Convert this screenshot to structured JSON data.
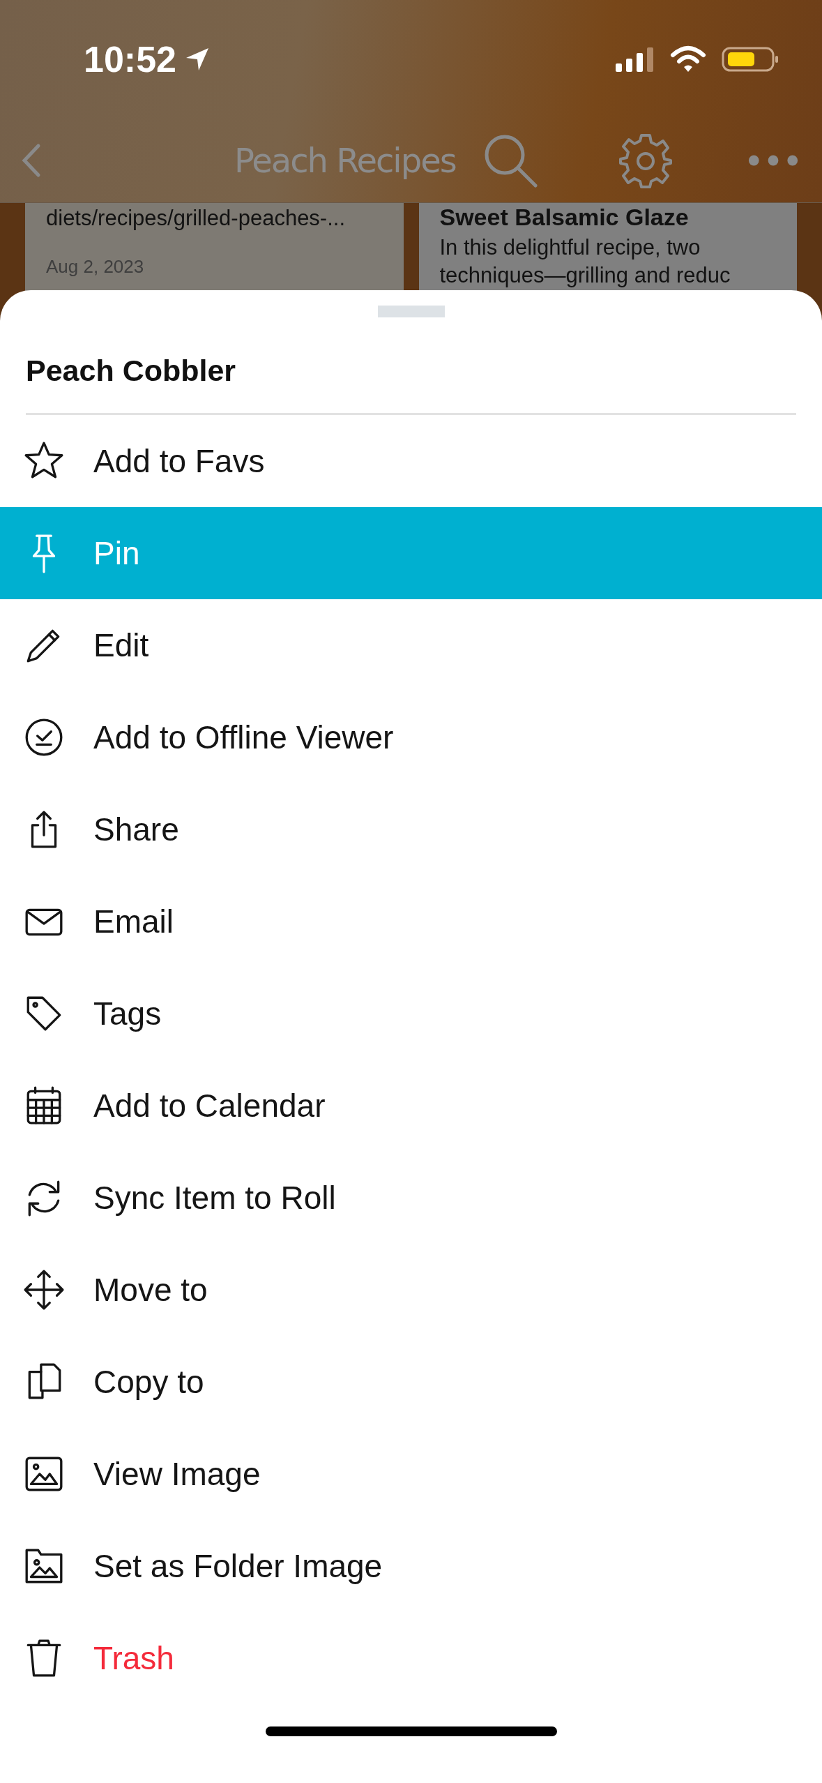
{
  "status_bar": {
    "time": "10:52"
  },
  "nav_bar": {
    "title": "Peach Recipes"
  },
  "background_cards": [
    {
      "lines": [
        "diets/recipes/grilled-peaches-..."
      ],
      "date": "Aug 2, 2023"
    },
    {
      "title": "Sweet Balsamic Glaze",
      "lines": [
        "In this delightful recipe, two",
        "techniques—grilling and reduc"
      ]
    }
  ],
  "sheet": {
    "title": "Peach Cobbler",
    "items": [
      {
        "label": "Add to Favs",
        "selected": false,
        "kind": "normal"
      },
      {
        "label": "Pin",
        "selected": true,
        "kind": "normal"
      },
      {
        "label": "Edit",
        "selected": false,
        "kind": "normal"
      },
      {
        "label": "Add to Offline Viewer",
        "selected": false,
        "kind": "normal"
      },
      {
        "label": "Share",
        "selected": false,
        "kind": "normal"
      },
      {
        "label": "Email",
        "selected": false,
        "kind": "normal"
      },
      {
        "label": "Tags",
        "selected": false,
        "kind": "normal"
      },
      {
        "label": "Add to Calendar",
        "selected": false,
        "kind": "normal"
      },
      {
        "label": "Sync Item to Roll",
        "selected": false,
        "kind": "normal"
      },
      {
        "label": "Move to",
        "selected": false,
        "kind": "normal"
      },
      {
        "label": "Copy to",
        "selected": false,
        "kind": "normal"
      },
      {
        "label": "View Image",
        "selected": false,
        "kind": "normal"
      },
      {
        "label": "Set as Folder Image",
        "selected": false,
        "kind": "normal"
      },
      {
        "label": "Trash",
        "selected": false,
        "kind": "destructive"
      }
    ]
  }
}
